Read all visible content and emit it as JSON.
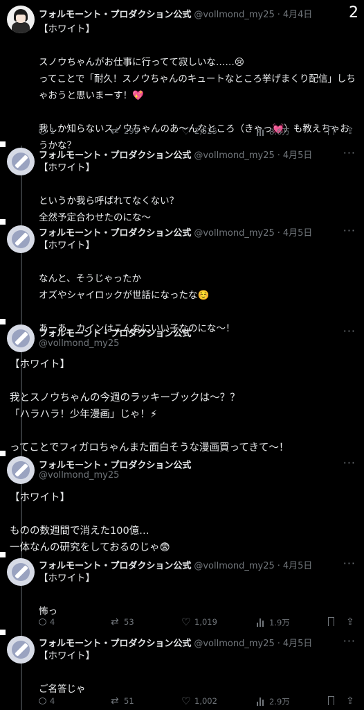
{
  "page_counter": "2",
  "author": {
    "name": "フォルモーント・プロダクション公式",
    "handle": "@vollmond_my25"
  },
  "tweets": [
    {
      "date": "4月4日",
      "lines": [
        "【ホワイト】",
        "",
        "スノウちゃんがお仕事に行ってて寂しいな……😢",
        "ってことで「耐久！スノウちゃんのキュートなところ挙げまくり配信」しちゃおうと思いまーす！💖",
        "",
        "我しか知らないスノウちゃんのあ〜んなところ（きゃっ💓）も教えちゃおうかな？"
      ],
      "stats": {
        "replies": "1",
        "retweets": "299",
        "likes": "2,525",
        "views": "8.6万"
      }
    },
    {
      "date": "4月5日",
      "lines": [
        "【ホワイト】",
        "",
        "というか我ら呼ばれてなくない？",
        "全然予定合わせたのにな〜"
      ]
    },
    {
      "date": "4月5日",
      "lines": [
        "【ホワイト】",
        "",
        "なんと、そうじゃったか",
        "オズやシャイロックが世話になったな☺️",
        "",
        "あーあ、カインはこんなにいい子なのにな〜！"
      ]
    },
    {
      "lines": [
        "【ホワイト】",
        "",
        "我とスノウちゃんの今週のラッキーブックは〜？？",
        "「ハラハラ！少年漫画」じゃ！⚡",
        "",
        "ってことでフィガロちゃんまた面白そうな漫画買ってきて〜！"
      ]
    },
    {
      "lines": [
        "【ホワイト】",
        "",
        "ものの数週間で消えた100億…",
        "一体なんの研究をしておるのじゃ😨"
      ]
    },
    {
      "date": "4月5日",
      "lines": [
        "【ホワイト】",
        "",
        "怖っ"
      ],
      "stats": {
        "replies": "4",
        "retweets": "53",
        "likes": "1,019",
        "views": "1.9万"
      }
    },
    {
      "date": "4月5日",
      "lines": [
        "【ホワイト】",
        "",
        "ご名答じゃ"
      ],
      "stats": {
        "replies": "4",
        "retweets": "51",
        "likes": "1,002",
        "views": "2.9万"
      }
    }
  ],
  "icons": {
    "more": "more-dots-icon",
    "reply": "reply-icon",
    "retweet": "retweet-icon",
    "like": "like-icon",
    "views": "views-icon",
    "bookmark": "bookmark-icon",
    "share": "share-icon"
  }
}
